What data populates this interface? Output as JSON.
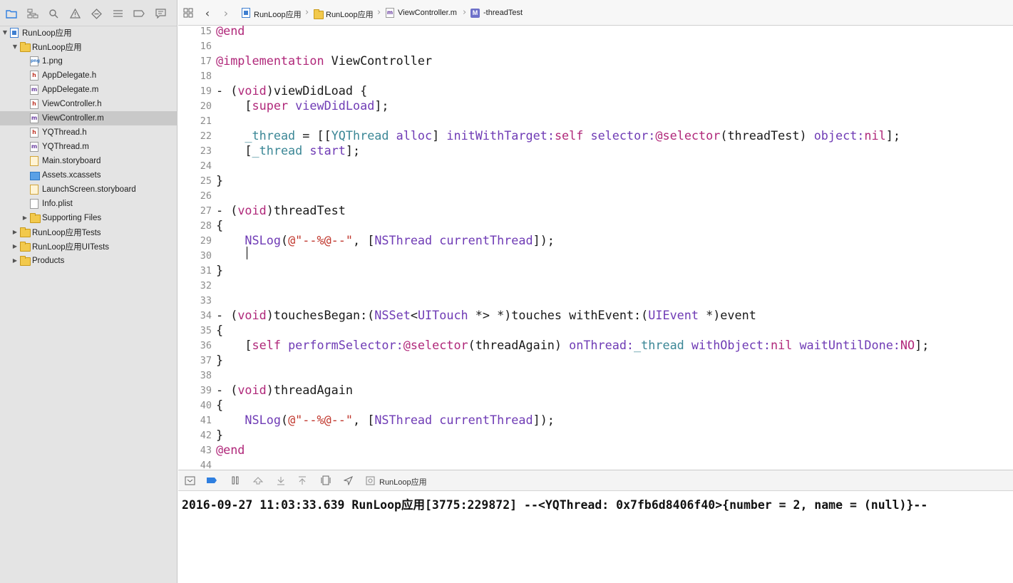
{
  "navigator": {
    "icons": [
      "folder-icon",
      "hierarchy-icon",
      "search-icon",
      "warning-icon",
      "test-icon",
      "debug-icon",
      "breakpoint-icon",
      "report-icon"
    ]
  },
  "tree": [
    {
      "label": "RunLoop应用",
      "kind": "project",
      "depth": 0,
      "disclosure": "open"
    },
    {
      "label": "RunLoop应用",
      "kind": "folder",
      "depth": 1,
      "disclosure": "open"
    },
    {
      "label": "1.png",
      "kind": "png",
      "depth": 2
    },
    {
      "label": "AppDelegate.h",
      "kind": "h",
      "depth": 2
    },
    {
      "label": "AppDelegate.m",
      "kind": "m",
      "depth": 2
    },
    {
      "label": "ViewController.h",
      "kind": "h",
      "depth": 2
    },
    {
      "label": "ViewController.m",
      "kind": "m",
      "depth": 2,
      "selected": true
    },
    {
      "label": "YQThread.h",
      "kind": "h",
      "depth": 2
    },
    {
      "label": "YQThread.m",
      "kind": "m",
      "depth": 2
    },
    {
      "label": "Main.storyboard",
      "kind": "storyboard",
      "depth": 2
    },
    {
      "label": "Assets.xcassets",
      "kind": "assets",
      "depth": 2
    },
    {
      "label": "LaunchScreen.storyboard",
      "kind": "storyboard",
      "depth": 2
    },
    {
      "label": "Info.plist",
      "kind": "plist",
      "depth": 2
    },
    {
      "label": "Supporting Files",
      "kind": "folder",
      "depth": 2,
      "disclosure": "closed"
    },
    {
      "label": "RunLoop应用Tests",
      "kind": "folder",
      "depth": 1,
      "disclosure": "closed"
    },
    {
      "label": "RunLoop应用UITests",
      "kind": "folder",
      "depth": 1,
      "disclosure": "closed"
    },
    {
      "label": "Products",
      "kind": "folder",
      "depth": 1,
      "disclosure": "closed"
    }
  ],
  "jumpbar": {
    "crumbs": [
      "RunLoop应用",
      "RunLoop应用",
      "ViewController.m",
      "-threadTest"
    ]
  },
  "editor": {
    "lines": [
      {
        "n": "15",
        "t": [
          [
            "@end",
            "kw"
          ]
        ]
      },
      {
        "n": "16",
        "t": []
      },
      {
        "n": "17",
        "t": [
          [
            "@implementation",
            "kw"
          ],
          [
            " ViewController",
            ""
          ]
        ]
      },
      {
        "n": "18",
        "t": []
      },
      {
        "n": "19",
        "t": [
          [
            "- (",
            ""
          ],
          [
            "void",
            "kw"
          ],
          [
            ")viewDidLoad {",
            ""
          ]
        ]
      },
      {
        "n": "20",
        "t": [
          [
            "    [",
            ""
          ],
          [
            "super",
            "kw"
          ],
          [
            " ",
            ""
          ],
          [
            "viewDidLoad",
            "ty"
          ],
          [
            "];",
            ""
          ]
        ]
      },
      {
        "n": "21",
        "t": []
      },
      {
        "n": "22",
        "t": [
          [
            "    ",
            ""
          ],
          [
            "_thread",
            "pj"
          ],
          [
            " = [[",
            ""
          ],
          [
            "YQThread",
            "pj"
          ],
          [
            " ",
            ""
          ],
          [
            "alloc",
            "ty"
          ],
          [
            "] ",
            ""
          ],
          [
            "initWithTarget:",
            "ty"
          ],
          [
            "self",
            "kw"
          ],
          [
            " ",
            ""
          ],
          [
            "selector:",
            "ty"
          ],
          [
            "@selector",
            "kw"
          ],
          [
            "(threadTest) ",
            ""
          ],
          [
            "object:",
            "ty"
          ],
          [
            "nil",
            "kw"
          ],
          [
            "];",
            ""
          ]
        ]
      },
      {
        "n": "23",
        "t": [
          [
            "    [",
            ""
          ],
          [
            "_thread",
            "pj"
          ],
          [
            " ",
            ""
          ],
          [
            "start",
            "ty"
          ],
          [
            "];",
            ""
          ]
        ]
      },
      {
        "n": "24",
        "t": []
      },
      {
        "n": "25",
        "t": [
          [
            "}",
            ""
          ]
        ]
      },
      {
        "n": "26",
        "t": []
      },
      {
        "n": "27",
        "t": [
          [
            "- (",
            ""
          ],
          [
            "void",
            "kw"
          ],
          [
            ")threadTest",
            ""
          ]
        ]
      },
      {
        "n": "28",
        "t": [
          [
            "{",
            ""
          ]
        ]
      },
      {
        "n": "29",
        "t": [
          [
            "    ",
            ""
          ],
          [
            "NSLog",
            "ty"
          ],
          [
            "(",
            ""
          ],
          [
            "@\"--%@--\"",
            "st"
          ],
          [
            ", [",
            ""
          ],
          [
            "NSThread",
            "ty"
          ],
          [
            " ",
            ""
          ],
          [
            "currentThread",
            "ty"
          ],
          [
            "]);",
            ""
          ]
        ]
      },
      {
        "n": "30",
        "t": []
      },
      {
        "n": "31",
        "t": [
          [
            "}",
            ""
          ]
        ]
      },
      {
        "n": "32",
        "t": []
      },
      {
        "n": "33",
        "t": []
      },
      {
        "n": "34",
        "t": [
          [
            "- (",
            ""
          ],
          [
            "void",
            "kw"
          ],
          [
            ")touchesBegan:(",
            ""
          ],
          [
            "NSSet",
            "ty"
          ],
          [
            "<",
            ""
          ],
          [
            "UITouch",
            "ty"
          ],
          [
            " *> *)touches withEvent:(",
            ""
          ],
          [
            "UIEvent",
            "ty"
          ],
          [
            " *)event",
            ""
          ]
        ]
      },
      {
        "n": "35",
        "t": [
          [
            "{",
            ""
          ]
        ]
      },
      {
        "n": "36",
        "t": [
          [
            "    [",
            ""
          ],
          [
            "self",
            "kw"
          ],
          [
            " ",
            ""
          ],
          [
            "performSelector:",
            "ty"
          ],
          [
            "@selector",
            "kw"
          ],
          [
            "(threadAgain) ",
            ""
          ],
          [
            "onThread:",
            "ty"
          ],
          [
            "_thread",
            "pj"
          ],
          [
            " ",
            ""
          ],
          [
            "withObject:",
            "ty"
          ],
          [
            "nil",
            "kw"
          ],
          [
            " ",
            ""
          ],
          [
            "waitUntilDone:",
            "ty"
          ],
          [
            "NO",
            "kw"
          ],
          [
            "];",
            ""
          ]
        ]
      },
      {
        "n": "37",
        "t": [
          [
            "}",
            ""
          ]
        ]
      },
      {
        "n": "38",
        "t": []
      },
      {
        "n": "39",
        "t": [
          [
            "- (",
            ""
          ],
          [
            "void",
            "kw"
          ],
          [
            ")threadAgain",
            ""
          ]
        ]
      },
      {
        "n": "40",
        "t": [
          [
            "{",
            ""
          ]
        ]
      },
      {
        "n": "41",
        "t": [
          [
            "    ",
            ""
          ],
          [
            "NSLog",
            "ty"
          ],
          [
            "(",
            ""
          ],
          [
            "@\"--%@--\"",
            "st"
          ],
          [
            ", [",
            ""
          ],
          [
            "NSThread",
            "ty"
          ],
          [
            " ",
            ""
          ],
          [
            "currentThread",
            "ty"
          ],
          [
            "]);",
            ""
          ]
        ]
      },
      {
        "n": "42",
        "t": [
          [
            "}",
            ""
          ]
        ]
      },
      {
        "n": "43",
        "t": [
          [
            "@end",
            "kw"
          ]
        ]
      },
      {
        "n": "44",
        "t": []
      }
    ]
  },
  "debugbar": {
    "scheme_label": "RunLoop应用"
  },
  "console": {
    "output": "2016-09-27 11:03:33.639 RunLoop应用[3775:229872] --<YQThread: 0x7fb6d8406f40>{number = 2, name = (null)}--"
  }
}
